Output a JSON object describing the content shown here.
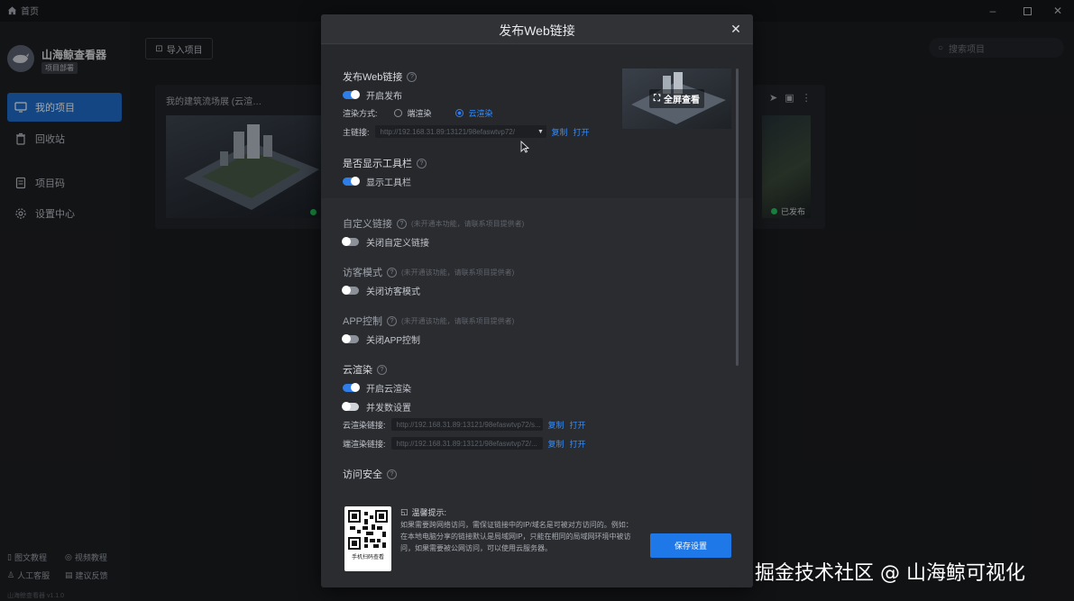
{
  "titlebar": {
    "home_tab": "首页"
  },
  "sidebar": {
    "app_name": "山海鲸查看器",
    "app_badge": "项目部署",
    "nav": [
      {
        "label": "我的项目",
        "icon": "monitor-icon",
        "active": true
      },
      {
        "label": "回收站",
        "icon": "trash-icon",
        "active": false
      },
      {
        "label": "项目码",
        "icon": "document-icon",
        "active": false
      },
      {
        "label": "设置中心",
        "icon": "gear-icon",
        "active": false
      }
    ],
    "footer": {
      "tutorial": "图文教程",
      "video": "视频教程",
      "service": "人工客服",
      "feedback": "建议反馈",
      "version": "山海鲸查看器 v1.1.0"
    }
  },
  "main": {
    "import_label": "导入项目",
    "search_placeholder": "搜索项目",
    "card1_title": "我的建筑流场展 (云渲…",
    "card2_status": "已发布"
  },
  "modal": {
    "title": "发布Web链接",
    "publish": {
      "title": "发布Web链接",
      "toggle_label": "开启发布",
      "render_mode_label": "渲染方式:",
      "render_options": [
        "端渲染",
        "云渲染"
      ],
      "render_selected": "云渲染",
      "main_link_label": "主链接:",
      "main_link": "http://192.168.31.89:13121/98efaswtvp72/",
      "copy": "复制",
      "open": "打开"
    },
    "fullscreen_label": "全屏查看",
    "toolbar": {
      "title": "是否显示工具栏",
      "toggle_label": "显示工具栏"
    },
    "custom_link": {
      "title": "自定义链接",
      "hint": "(未开通本功能，请联系项目提供者)",
      "toggle_label": "关闭自定义链接"
    },
    "guest_mode": {
      "title": "访客模式",
      "hint": "(未开通该功能，请联系项目提供者)",
      "toggle_label": "关闭访客模式"
    },
    "app_control": {
      "title": "APP控制",
      "hint": "(未开通该功能，请联系项目提供者)",
      "toggle_label": "关闭APP控制"
    },
    "cloud_render": {
      "title": "云渲染",
      "toggle_label": "开启云渲染",
      "concurrency_label": "并发数设置",
      "cloud_link_label": "云渲染链接:",
      "cloud_link": "http://192.168.31.89:13121/98efaswtvp72/s...",
      "edge_link_label": "端渲染链接:",
      "edge_link": "http://192.168.31.89:13121/98efaswtvp72/...",
      "copy": "复制",
      "open": "打开"
    },
    "access_security": {
      "title": "访问安全"
    },
    "qr_caption": "手机扫码查看",
    "tip": {
      "title": "温馨提示:",
      "text": "如果需要跨网络访问，需保证链接中的IP/域名是可被对方访问的。例如：在本地电脑分享的链接默认是局域网IP，只能在相同的局域网环境中被访问，如果需要被公网访问，可以使用云服务器。"
    },
    "save_label": "保存设置"
  },
  "watermark": "掘金技术社区 @ 山海鲸可视化",
  "colors": {
    "accent": "#1e78e8",
    "link": "#2f8cff",
    "status_ok": "#22c55e"
  }
}
